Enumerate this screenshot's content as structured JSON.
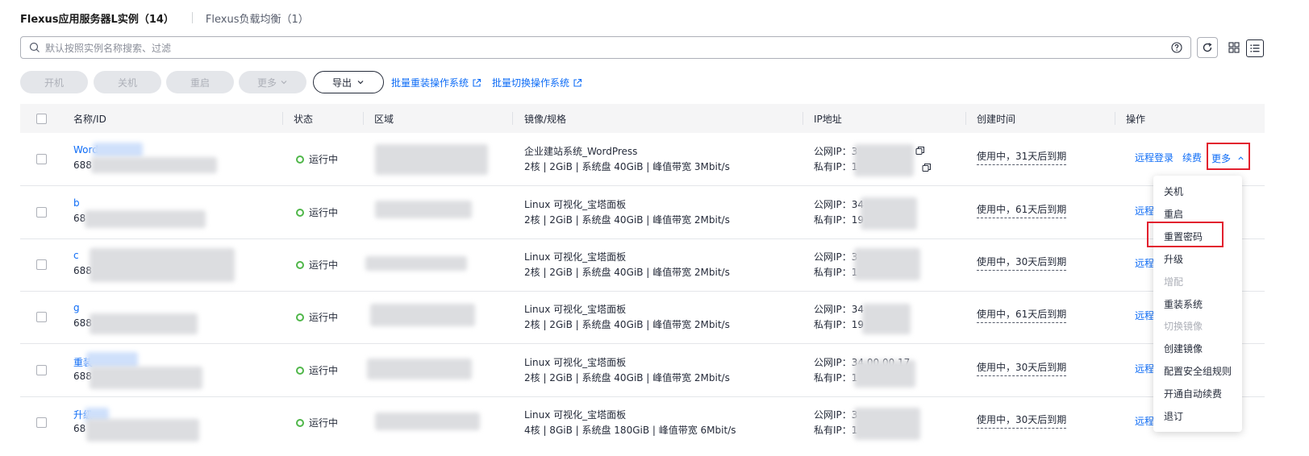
{
  "tabs": {
    "active": "Flexus应用服务器L实例（14）",
    "other": "Flexus负载均衡（1）"
  },
  "search": {
    "placeholder": "默认按照实例名称搜索、过滤"
  },
  "toolbar": {
    "start": "开机",
    "stop": "关机",
    "reboot": "重启",
    "more": "更多",
    "export": "导出",
    "batch_reinstall": "批量重装操作系统",
    "batch_switch": "批量切换操作系统"
  },
  "table": {
    "headers": {
      "name": "名称/ID",
      "status": "状态",
      "region": "区域",
      "image": "镜像/规格",
      "ip": "IP地址",
      "created": "创建时间",
      "ops": "操作"
    },
    "rows": [
      {
        "name": "Word",
        "id": "688",
        "status": "运行中",
        "image": "企业建站系统_WordPress",
        "spec": "2核 | 2GiB | 系统盘 40GiB | 峰值带宽 3Mbit/s",
        "pub_ip": "公网IP：3",
        "priv_ip": "私有IP：1",
        "created": "使用中，31天后到期",
        "op1": "远程登录",
        "op2": "续费",
        "op3": "更多"
      },
      {
        "name": "b",
        "id": "68",
        "status": "运行中",
        "image": "Linux 可视化_宝塔面板",
        "spec": "2核 | 2GiB | 系统盘 40GiB | 峰值带宽 2Mbit/s",
        "pub_ip": "公网IP：34",
        "priv_ip": "私有IP：19",
        "created": "使用中，61天后到期",
        "op1": "远程"
      },
      {
        "name": "c",
        "id": "688",
        "status": "运行中",
        "image": "Linux 可视化_宝塔面板",
        "spec": "2核 | 2GiB | 系统盘 40GiB | 峰值带宽 2Mbit/s",
        "pub_ip": "公网IP：3",
        "priv_ip": "私有IP：1",
        "created": "使用中，30天后到期",
        "op1": "远程"
      },
      {
        "name": "g",
        "id": "688",
        "status": "运行中",
        "image": "Linux 可视化_宝塔面板",
        "spec": "2核 | 2GiB | 系统盘 40GiB | 峰值带宽 2Mbit/s",
        "pub_ip": "公网IP：34",
        "priv_ip": "私有IP：19",
        "created": "使用中，61天后到期",
        "op1": "远程"
      },
      {
        "name": "重装",
        "id": "688",
        "status": "运行中",
        "image": "Linux 可视化_宝塔面板",
        "spec": "2核 | 2GiB | 系统盘 40GiB | 峰值带宽 2Mbit/s",
        "pub_ip": "公网IP：34.00.00.17",
        "priv_ip": "私有IP：1",
        "created": "使用中，30天后到期",
        "op1": "远程"
      },
      {
        "name": "升级",
        "id": "68",
        "status": "运行中",
        "image": "Linux 可视化_宝塔面板",
        "spec": "4核 | 8GiB | 系统盘 180GiB | 峰值带宽 6Mbit/s",
        "pub_ip": "公网IP：3",
        "priv_ip": "私有IP：1",
        "created": "使用中，30天后到期",
        "op1": "远程"
      }
    ]
  },
  "more_menu": {
    "items": [
      {
        "label": "关机",
        "disabled": false
      },
      {
        "label": "重启",
        "disabled": false
      },
      {
        "label": "重置密码",
        "disabled": false
      },
      {
        "label": "升级",
        "disabled": false
      },
      {
        "label": "增配",
        "disabled": true
      },
      {
        "label": "重装系统",
        "disabled": false
      },
      {
        "label": "切换镜像",
        "disabled": true
      },
      {
        "label": "创建镜像",
        "disabled": false
      },
      {
        "label": "配置安全组规则",
        "disabled": false
      },
      {
        "label": "开通自动续费",
        "disabled": false
      },
      {
        "label": "退订",
        "disabled": false
      }
    ]
  },
  "colors": {
    "link": "#0e6cf6",
    "highlight": "#e2202e",
    "running": "#50b74a"
  }
}
